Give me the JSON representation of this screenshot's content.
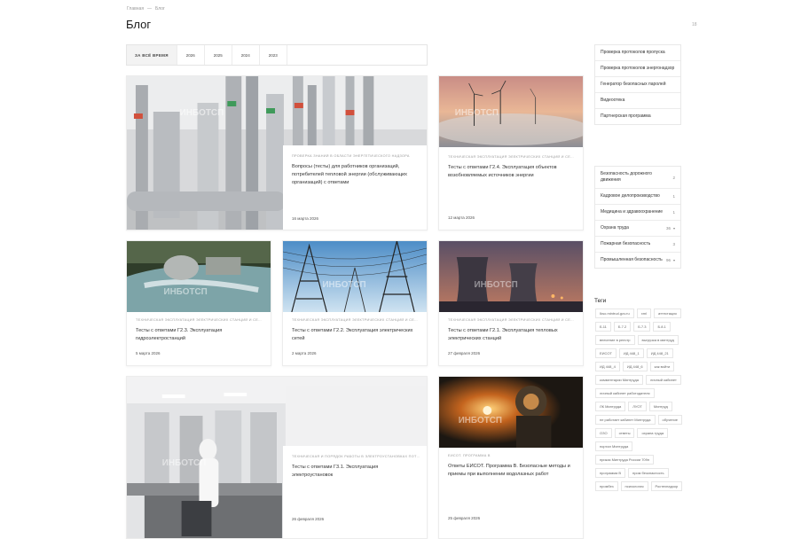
{
  "breadcrumb": {
    "home": "Главная",
    "sep": "—",
    "current": "Блог"
  },
  "page": {
    "title": "Блог",
    "count": "18"
  },
  "filters": [
    "ЗА ВСЁ ВРЕМЯ",
    "2026",
    "2025",
    "2024",
    "2023"
  ],
  "cards": [
    {
      "category": "ПРОВЕРКА ЗНАНИЙ В ОБЛАСТИ ЭНЕРГЕТИЧЕСКОГО НАДЗОРА",
      "title": "Вопросы (тесты) для работников организаций, потребителей тепловой энергии (обслуживающих организаций) с ответами",
      "date": "16 марта 2026"
    },
    {
      "category": "ТЕХНИЧЕСКАЯ ЭКСПЛУАТАЦИЯ ЭЛЕКТРИЧЕСКИХ СТАНЦИЙ И СЕТЕЙ",
      "title": "Тесты с ответами Г2.4. Эксплуатация объектов возобновляемых источников энергии",
      "date": "12 марта 2026"
    },
    {
      "category": "ТЕХНИЧЕСКАЯ ЭКСПЛУАТАЦИЯ ЭЛЕКТРИЧЕСКИХ СТАНЦИЙ И СЕТЕЙ",
      "title": "Тесты с ответами Г2.3. Эксплуатация гидроэлектростанций",
      "date": "5 марта 2026"
    },
    {
      "category": "ТЕХНИЧЕСКАЯ ЭКСПЛУАТАЦИЯ ЭЛЕКТРИЧЕСКИХ СТАНЦИЙ И СЕТЕЙ",
      "title": "Тесты с ответами Г2.2. Эксплуатация электрических сетей",
      "date": "2 марта 2026"
    },
    {
      "category": "ТЕХНИЧЕСКАЯ ЭКСПЛУАТАЦИЯ ЭЛЕКТРИЧЕСКИХ СТАНЦИЙ И СЕТЕЙ",
      "title": "Тесты с ответами Г2.1. Эксплуатация тепловых электрических станций",
      "date": "27 февраля 2026"
    },
    {
      "category": "ТЕХНИЧЕСКАЯ И ПОРЯДОК РАБОТЫ В ЭЛЕКТРОУСТАНОВКАХ ПОТРЕБИТЕЛЕЙ",
      "title": "Тесты с ответами Г3.1. Эксплуатация электроустановок",
      "date": "26 февраля 2026"
    },
    {
      "category": "ЕИСОТ. ПРОГРАММА В",
      "title": "Ответы ЕИСОТ. Программа В. Безопасные методы и приемы при выполнении водолазных работ",
      "date": "25 февраля 2026"
    }
  ],
  "watermark": "ИНБОТСП",
  "sidebar_links": [
    "Проверка протоколов пропуска",
    "Проверка протоколов энергонадзор",
    "Генератор безопасных паролей",
    "Видеоотека",
    "Партнерская программа"
  ],
  "categories": [
    {
      "label": "Безопасность дорожного движения",
      "count": "2",
      "expandable": false
    },
    {
      "label": "Кадровое делопроизводство",
      "count": "1",
      "expandable": false
    },
    {
      "label": "Медицина и здравоохранение",
      "count": "1",
      "expandable": false
    },
    {
      "label": "Охрана труда",
      "count": "36",
      "expandable": true
    },
    {
      "label": "Пожарная безопасность",
      "count": "3",
      "expandable": false
    },
    {
      "label": "Промышленная безопасность",
      "count": "96",
      "expandable": true
    }
  ],
  "tags_title": "Теги",
  "tags": [
    "Ikso.mintrud.gov.ru",
    "xml",
    "аттестация",
    "Б.11",
    "Б.7.2",
    "Б.7.3",
    "Б.8.1",
    "внесение в реестр",
    "выгрузка в минтруд",
    "ЕИСОТ",
    "ИД 448_1",
    "ИД 448_21",
    "ИД 448_4",
    "ИД 448_6",
    "как войти",
    "комментарии Минтруда",
    "личный кабинет",
    "личный кабинет работодателя",
    "ЛК Минтруда",
    "ЛУОТ",
    "Минтруд",
    "не работает кабинет Минтруда",
    "обучение",
    "ОЗО",
    "ответы",
    "охрана труда",
    "портал Минтруда",
    "приказ Минтруда России 709н",
    "программа В",
    "пром безопасность",
    "промбез",
    "психология",
    "Ростехнадзор"
  ]
}
